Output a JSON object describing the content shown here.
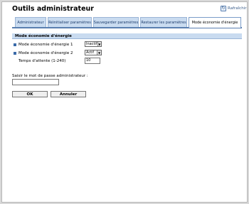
{
  "header": {
    "title": "Outils administrateur",
    "refresh_label": "Rafraîchir",
    "refresh_icon": "refresh-icon"
  },
  "tabs": [
    {
      "label": "Administrateur",
      "active": false
    },
    {
      "label": "Réinitialiser paramètres",
      "active": false
    },
    {
      "label": "Sauvegarder paramètres",
      "active": false
    },
    {
      "label": "Restaurer les paramètres",
      "active": false
    },
    {
      "label": "Mode économie d'énergie",
      "active": true
    }
  ],
  "section": {
    "title": "Mode économie d'énergie",
    "rows": [
      {
        "label": "Mode économie d'énergie 1",
        "value": "Inactif"
      },
      {
        "label": "Mode économie d'énergie 2",
        "value": "Actif"
      },
      {
        "label": "Temps d'attente (1-240)",
        "value": "10"
      }
    ]
  },
  "password": {
    "label": "Saisir le mot de passe administrateur :",
    "value": ""
  },
  "buttons": {
    "ok": "OK",
    "cancel": "Annuler"
  }
}
